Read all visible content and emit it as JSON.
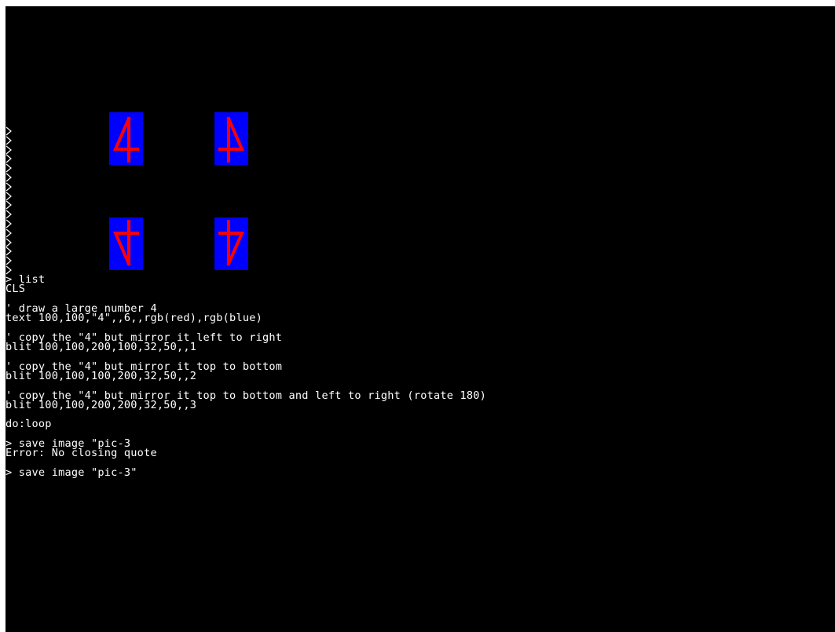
{
  "colors": {
    "screen_background": "#000000",
    "text": "#ffffff",
    "glyph_fill": "#ff0000",
    "glyph_background": "#0000ff"
  },
  "graphics": {
    "digit": "4",
    "panels": [
      {
        "name": "original",
        "transform": "none"
      },
      {
        "name": "mirror-left-right",
        "transform": "flip-horizontal"
      },
      {
        "name": "mirror-top-bottom",
        "transform": "flip-vertical"
      },
      {
        "name": "rotate-180",
        "transform": "flip-both"
      }
    ]
  },
  "prompt_char": ">",
  "console_lines": [
    "> list",
    "CLS",
    "",
    "' draw a large number 4",
    "text 100,100,\"4\",,6,,rgb(red),rgb(blue)",
    "",
    "' copy the \"4\" but mirror it left to right",
    "blit 100,100,200,100,32,50,,1",
    "",
    "' copy the \"4\" but mirror it top to bottom",
    "blit 100,100,100,200,32,50,,2",
    "",
    "' copy the \"4\" but mirror it top to bottom and left to right (rotate 180)",
    "blit 100,100,200,200,32,50,,3",
    "",
    "do:loop",
    "",
    "> save image \"pic-3",
    "Error: No closing quote",
    "",
    "> save image \"pic-3\""
  ]
}
